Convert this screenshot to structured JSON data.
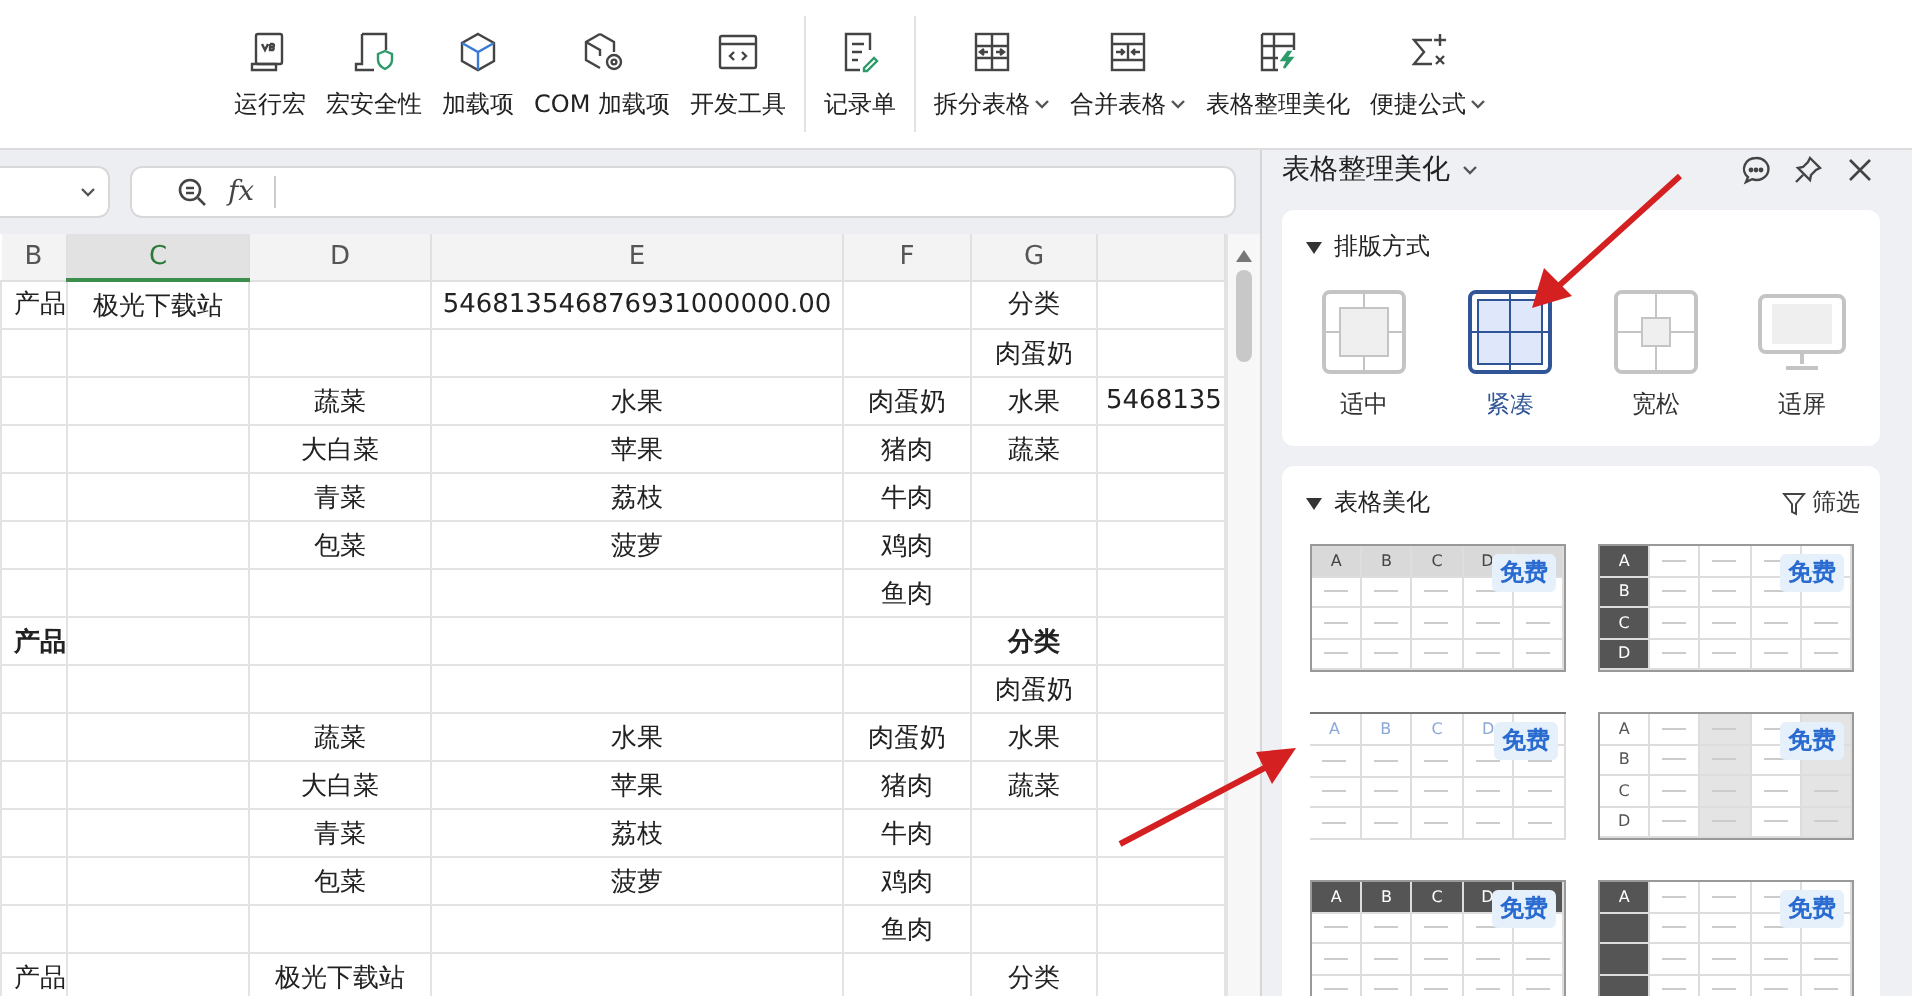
{
  "ribbon": {
    "groups": [
      {
        "items": [
          {
            "kind": "vb",
            "label": "运行宏",
            "dropdown": false
          },
          {
            "kind": "shield",
            "label": "宏安全性",
            "dropdown": false
          },
          {
            "kind": "cube",
            "label": "加载项",
            "dropdown": false
          },
          {
            "kind": "cubegear",
            "label": "COM 加载项",
            "dropdown": false
          },
          {
            "kind": "code",
            "label": "开发工具",
            "dropdown": false
          }
        ]
      },
      {
        "items": [
          {
            "kind": "form",
            "label": "记录单",
            "dropdown": false
          }
        ]
      },
      {
        "items": [
          {
            "kind": "split",
            "label": "拆分表格",
            "dropdown": true
          },
          {
            "kind": "merge",
            "label": "合并表格",
            "dropdown": true
          },
          {
            "kind": "beautify",
            "label": "表格整理美化",
            "dropdown": false
          },
          {
            "kind": "sigma",
            "label": "便捷公式",
            "dropdown": true
          }
        ]
      }
    ]
  },
  "formula_bar": {
    "fx": "fx"
  },
  "grid": {
    "columns": [
      {
        "label": "B",
        "selected": false
      },
      {
        "label": "C",
        "selected": true
      },
      {
        "label": "D",
        "selected": false
      },
      {
        "label": "E",
        "selected": false
      },
      {
        "label": "F",
        "selected": false
      },
      {
        "label": "G",
        "selected": false
      },
      {
        "selected": false
      }
    ],
    "rows": [
      {
        "bold": false,
        "cells": [
          "产品",
          "极光下载站",
          null,
          "546813546876931000000.00",
          null,
          "分类",
          null
        ]
      },
      {
        "bold": false,
        "cells": [
          null,
          null,
          null,
          null,
          null,
          "肉蛋奶",
          null
        ]
      },
      {
        "bold": false,
        "cells": [
          null,
          null,
          "蔬菜",
          "水果",
          "肉蛋奶",
          "水果",
          "5468135"
        ]
      },
      {
        "bold": false,
        "cells": [
          null,
          null,
          "大白菜",
          "苹果",
          "猪肉",
          "蔬菜",
          null
        ]
      },
      {
        "bold": false,
        "cells": [
          null,
          null,
          "青菜",
          "荔枝",
          "牛肉",
          null,
          null
        ]
      },
      {
        "bold": false,
        "cells": [
          null,
          null,
          "包菜",
          "菠萝",
          "鸡肉",
          null,
          null
        ]
      },
      {
        "bold": false,
        "cells": [
          null,
          null,
          null,
          null,
          "鱼肉",
          null,
          null
        ]
      },
      {
        "bold": true,
        "cells": [
          "产品",
          null,
          null,
          null,
          null,
          "分类",
          null
        ]
      },
      {
        "bold": false,
        "cells": [
          null,
          null,
          null,
          null,
          null,
          "肉蛋奶",
          null
        ]
      },
      {
        "bold": false,
        "cells": [
          null,
          null,
          "蔬菜",
          "水果",
          "肉蛋奶",
          "水果",
          null
        ]
      },
      {
        "bold": false,
        "cells": [
          null,
          null,
          "大白菜",
          "苹果",
          "猪肉",
          "蔬菜",
          null
        ]
      },
      {
        "bold": false,
        "cells": [
          null,
          null,
          "青菜",
          "荔枝",
          "牛肉",
          null,
          null
        ]
      },
      {
        "bold": false,
        "cells": [
          null,
          null,
          "包菜",
          "菠萝",
          "鸡肉",
          null,
          null
        ]
      },
      {
        "bold": false,
        "cells": [
          null,
          null,
          null,
          null,
          "鱼肉",
          null,
          null
        ]
      },
      {
        "bold": false,
        "cells": [
          "产品",
          null,
          "极光下载站",
          null,
          null,
          "分类",
          null
        ]
      }
    ]
  },
  "panel": {
    "title": "表格整理美化",
    "layout": {
      "heading": "排版方式",
      "options": [
        {
          "kind": "medium",
          "label": "适中",
          "selected": false
        },
        {
          "kind": "compact",
          "label": "紧凑",
          "selected": true
        },
        {
          "kind": "loose",
          "label": "宽松",
          "selected": false
        },
        {
          "kind": "screen",
          "label": "适屏",
          "selected": false
        }
      ]
    },
    "beautify": {
      "heading": "表格美化",
      "filter": "筛选",
      "templates": [
        {
          "kind": "top-light",
          "labels": [
            "A",
            "B",
            "C",
            "D"
          ],
          "badge": "免费"
        },
        {
          "kind": "left-dark",
          "labels": [
            "A",
            "B",
            "C",
            "D"
          ],
          "badge": "免费"
        },
        {
          "kind": "top-plain",
          "labels": [
            "A",
            "B",
            "C",
            "D"
          ],
          "badge": "免费"
        },
        {
          "kind": "left-banded",
          "labels": [
            "A",
            "B",
            "C",
            "D"
          ],
          "badge": "免费"
        },
        {
          "kind": "top-dark",
          "labels": [
            "A",
            "B",
            "C",
            "D"
          ],
          "badge": "免费"
        },
        {
          "kind": "left-dark",
          "labels": [
            "A"
          ],
          "badge": "免费"
        }
      ]
    }
  }
}
